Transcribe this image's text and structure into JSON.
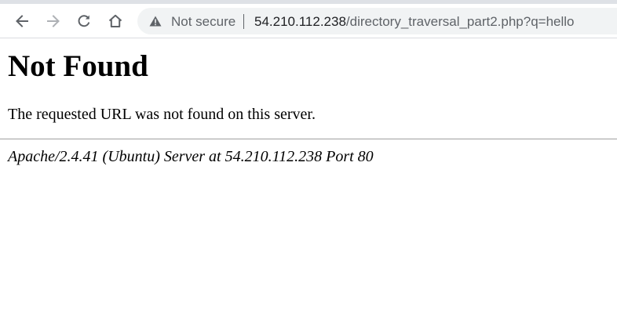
{
  "browser": {
    "security_label": "Not secure",
    "url_host": "54.210.112.238",
    "url_path": "/directory_traversal_part2.php?q=hello",
    "icons": {
      "back": "arrow-left-icon",
      "forward": "arrow-right-icon",
      "reload": "reload-icon",
      "home": "home-icon",
      "security": "warning-triangle-icon"
    }
  },
  "page": {
    "title": "Not Found",
    "message": "The requested URL was not found on this server.",
    "server_signature": "Apache/2.4.41 (Ubuntu) Server at 54.210.112.238 Port 80"
  }
}
